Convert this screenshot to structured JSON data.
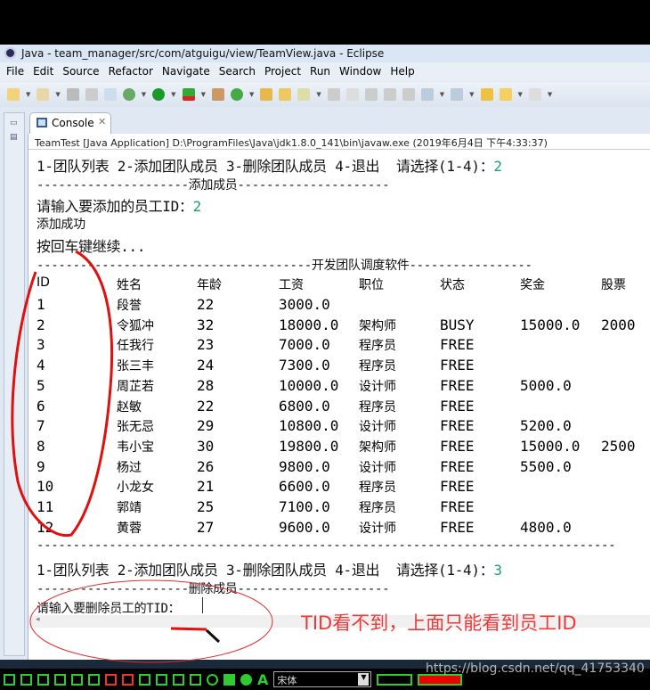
{
  "window": {
    "title": "Java - team_manager/src/com/atguigu/view/TeamView.java - Eclipse"
  },
  "menu": [
    "File",
    "Edit",
    "Source",
    "Refactor",
    "Navigate",
    "Search",
    "Project",
    "Run",
    "Window",
    "Help"
  ],
  "tab": {
    "label": "Console"
  },
  "console": {
    "header": "TeamTest [Java Application] D:\\ProgramFiles\\Java\\jdk1.8.0_141\\bin\\javaw.exe (2019年6月4日 下午4:33:37)",
    "menu_prompt": "1-团队列表 2-添加团队成员 3-删除团队成员 4-退出  请选择(1-4)：",
    "input1": "2",
    "add_divider": "---------------------添加成员---------------------",
    "add_prompt": "请输入要添加的员工ID：",
    "input2": "2",
    "add_success": "添加成功",
    "press_enter": "按回车键继续...",
    "list_divider": "--------------------------------------开发团队调度软件-----------------",
    "columns": [
      "ID",
      "姓名",
      "年龄",
      "工资",
      "职位",
      "状态",
      "奖金",
      "股票"
    ],
    "rows": [
      [
        "1",
        "段誉",
        "22",
        "3000.0",
        "",
        "",
        "",
        ""
      ],
      [
        "2",
        "令狐冲",
        "32",
        "18000.0",
        "架构师",
        "BUSY",
        "15000.0",
        "2000"
      ],
      [
        "3",
        "任我行",
        "23",
        "7000.0",
        "程序员",
        "FREE",
        "",
        ""
      ],
      [
        "4",
        "张三丰",
        "24",
        "7300.0",
        "程序员",
        "FREE",
        "",
        ""
      ],
      [
        "5",
        "周芷若",
        "28",
        "10000.0",
        "设计师",
        "FREE",
        "5000.0",
        ""
      ],
      [
        "6",
        "赵敏",
        "22",
        "6800.0",
        "程序员",
        "FREE",
        "",
        ""
      ],
      [
        "7",
        "张无忌",
        "29",
        "10800.0",
        "设计师",
        "FREE",
        "5200.0",
        ""
      ],
      [
        "8",
        "韦小宝",
        "30",
        "19800.0",
        "架构师",
        "FREE",
        "15000.0",
        "2500"
      ],
      [
        "9",
        "杨过",
        "26",
        "9800.0",
        "设计师",
        "FREE",
        "5500.0",
        ""
      ],
      [
        "10",
        "小龙女",
        "21",
        "6600.0",
        "程序员",
        "FREE",
        "",
        ""
      ],
      [
        "11",
        "郭靖",
        "25",
        "7100.0",
        "程序员",
        "FREE",
        "",
        ""
      ],
      [
        "12",
        "黄蓉",
        "27",
        "9600.0",
        "设计师",
        "FREE",
        "4800.0",
        ""
      ]
    ],
    "end_divider": "--------------------------------------------------------------------------------",
    "menu_prompt2": "1-团队列表 2-添加团队成员 3-删除团队成员 4-退出  请选择(1-4)：",
    "input3": "3",
    "del_divider": "---------------------删除成员---------------------",
    "del_prompt": "请输入要删除员工的TID："
  },
  "annotation": {
    "note": "TID看不到，上面只能看到员工ID",
    "color": "#f03838"
  },
  "bottom": {
    "font_select": "宋体",
    "watermark": "https://blog.csdn.net/qq_41753340"
  }
}
